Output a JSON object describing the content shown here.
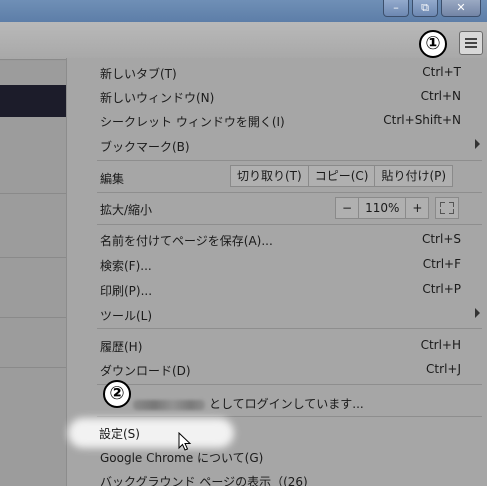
{
  "window": {
    "minimize_glyph": "–",
    "restore_glyph": "⧉",
    "close_glyph": "✕"
  },
  "annotations": {
    "marker1": "①",
    "marker2": "②"
  },
  "menu": {
    "new_tab": {
      "label": "新しいタブ(T)",
      "shortcut": "Ctrl+T"
    },
    "new_window": {
      "label": "新しいウィンドウ(N)",
      "shortcut": "Ctrl+N"
    },
    "incognito": {
      "label": "シークレット ウィンドウを開く(I)",
      "shortcut": "Ctrl+Shift+N"
    },
    "bookmarks": {
      "label": "ブックマーク(B)"
    },
    "edit": {
      "label": "編集",
      "cut": "切り取り(T)",
      "copy": "コピー(C)",
      "paste": "貼り付け(P)"
    },
    "zoom": {
      "label": "拡大/縮小",
      "minus": "−",
      "value": "110%",
      "plus": "+"
    },
    "save_page": {
      "label": "名前を付けてページを保存(A)...",
      "shortcut": "Ctrl+S"
    },
    "find": {
      "label": "検索(F)...",
      "shortcut": "Ctrl+F"
    },
    "print": {
      "label": "印刷(P)...",
      "shortcut": "Ctrl+P"
    },
    "tools": {
      "label": "ツール(L)"
    },
    "history": {
      "label": "履歴(H)",
      "shortcut": "Ctrl+H"
    },
    "downloads": {
      "label": "ダウンロード(D)",
      "shortcut": "Ctrl+J"
    },
    "signed_in": {
      "label": "としてログインしています..."
    },
    "settings": {
      "label": "設定(S)"
    },
    "about": {
      "label": "Google Chrome について(G)"
    },
    "background_pages": {
      "label": "バックグラウンド ページの表示（(26)"
    }
  }
}
